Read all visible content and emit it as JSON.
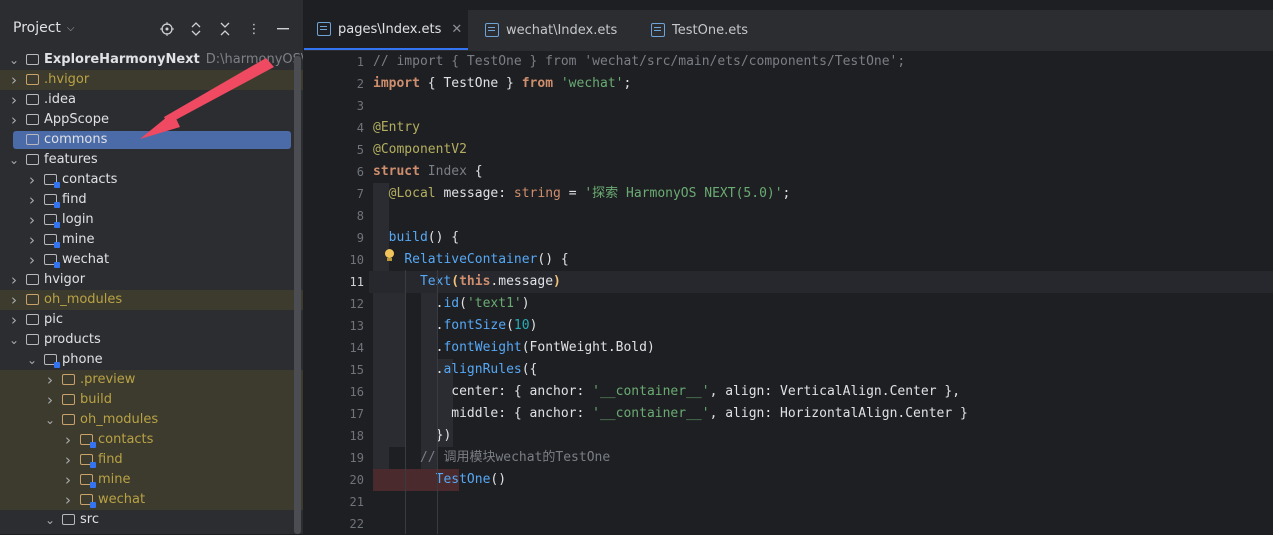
{
  "project_panel": {
    "title": "Project",
    "actions": [
      "locate-icon",
      "expand-collapse-icon",
      "collapse-all-icon",
      "more-icon",
      "hide-icon"
    ]
  },
  "tree": [
    {
      "label": "ExploreHarmonyNext",
      "path": "D:\\harmonyOS\\public\\",
      "indent": 0,
      "expanded": true,
      "bold": true,
      "style": "normal"
    },
    {
      "label": ".hvigor",
      "indent": 0,
      "expanded": false,
      "style": "excluded"
    },
    {
      "label": ".idea",
      "indent": 0,
      "expanded": false,
      "style": "normal"
    },
    {
      "label": "AppScope",
      "indent": 0,
      "expanded": false,
      "style": "normal"
    },
    {
      "label": "commons",
      "indent": 0,
      "expanded": null,
      "style": "selected"
    },
    {
      "label": "features",
      "indent": 0,
      "expanded": true,
      "style": "normal"
    },
    {
      "label": "contacts",
      "indent": 1,
      "expanded": false,
      "style": "normal",
      "module": true
    },
    {
      "label": "find",
      "indent": 1,
      "expanded": false,
      "style": "normal",
      "module": true
    },
    {
      "label": "login",
      "indent": 1,
      "expanded": false,
      "style": "normal",
      "module": true
    },
    {
      "label": "mine",
      "indent": 1,
      "expanded": false,
      "style": "normal",
      "module": true
    },
    {
      "label": "wechat",
      "indent": 1,
      "expanded": false,
      "style": "normal",
      "module": true
    },
    {
      "label": "hvigor",
      "indent": 0,
      "expanded": false,
      "style": "normal"
    },
    {
      "label": "oh_modules",
      "indent": 0,
      "expanded": false,
      "style": "excluded"
    },
    {
      "label": "pic",
      "indent": 0,
      "expanded": false,
      "style": "normal"
    },
    {
      "label": "products",
      "indent": 0,
      "expanded": true,
      "style": "normal"
    },
    {
      "label": "phone",
      "indent": 1,
      "expanded": true,
      "style": "normal",
      "module": true
    },
    {
      "label": ".preview",
      "indent": 2,
      "expanded": false,
      "style": "excluded"
    },
    {
      "label": "build",
      "indent": 2,
      "expanded": false,
      "style": "excluded"
    },
    {
      "label": "oh_modules",
      "indent": 2,
      "expanded": true,
      "style": "excluded"
    },
    {
      "label": "contacts",
      "indent": 3,
      "expanded": false,
      "style": "excluded",
      "module": true
    },
    {
      "label": "find",
      "indent": 3,
      "expanded": false,
      "style": "excluded",
      "module": true
    },
    {
      "label": "mine",
      "indent": 3,
      "expanded": false,
      "style": "excluded",
      "module": true
    },
    {
      "label": "wechat",
      "indent": 3,
      "expanded": false,
      "style": "excluded",
      "module": true
    },
    {
      "label": "src",
      "indent": 2,
      "expanded": true,
      "style": "normal"
    }
  ],
  "tabs": [
    {
      "label": "pages\\Index.ets",
      "active": true,
      "closable": true
    },
    {
      "label": "wechat\\Index.ets",
      "active": false,
      "closable": false
    },
    {
      "label": "TestOne.ets",
      "active": false,
      "closable": false
    }
  ],
  "current_line": 11,
  "code_lines": [
    [
      [
        "cm",
        "// import { TestOne } from 'wechat/src/main/ets/components/TestOne';"
      ]
    ],
    [
      [
        "kw",
        "import"
      ],
      [
        "pl",
        " { TestOne } "
      ],
      [
        "kw",
        "from"
      ],
      [
        "pl",
        " "
      ],
      [
        "str",
        "'wechat'"
      ],
      [
        "pl",
        ";"
      ]
    ],
    [],
    [
      [
        "dec",
        "@Entry"
      ]
    ],
    [
      [
        "dec",
        "@ComponentV2"
      ]
    ],
    [
      [
        "kw",
        "struct"
      ],
      [
        "pl",
        " "
      ],
      [
        "cm",
        "Index"
      ],
      [
        "pl",
        " {"
      ]
    ],
    [
      [
        "pl",
        "  "
      ],
      [
        "dec",
        "@Local"
      ],
      [
        "pl",
        " message: "
      ],
      [
        "ty",
        "string"
      ],
      [
        "pl",
        " = "
      ],
      [
        "str",
        "'探索 HarmonyOS NEXT(5.0)'"
      ],
      [
        "pl",
        ";"
      ]
    ],
    [],
    [
      [
        "pl",
        "  "
      ],
      [
        "fn",
        "build"
      ],
      [
        "pl",
        "() {"
      ]
    ],
    [
      [
        "pl",
        "    "
      ],
      [
        "fn",
        "RelativeContainer"
      ],
      [
        "pl",
        "() {"
      ]
    ],
    [
      [
        "pl",
        "      "
      ],
      [
        "fn",
        "Text"
      ],
      [
        "kw2",
        "("
      ],
      [
        "kw",
        "this"
      ],
      [
        "pl",
        ".message"
      ],
      [
        "kw2",
        ")"
      ]
    ],
    [
      [
        "pl",
        "        ."
      ],
      [
        "fn",
        "id"
      ],
      [
        "pl",
        "("
      ],
      [
        "str",
        "'text1'"
      ],
      [
        "pl",
        ")"
      ]
    ],
    [
      [
        "pl",
        "        ."
      ],
      [
        "fn",
        "fontSize"
      ],
      [
        "pl",
        "("
      ],
      [
        "num",
        "10"
      ],
      [
        "pl",
        ")"
      ]
    ],
    [
      [
        "pl",
        "        ."
      ],
      [
        "fn",
        "fontWeight"
      ],
      [
        "pl",
        "(FontWeight.Bold)"
      ]
    ],
    [
      [
        "pl",
        "        ."
      ],
      [
        "fn",
        "alignRules"
      ],
      [
        "pl",
        "({"
      ]
    ],
    [
      [
        "pl",
        "          center: { anchor: "
      ],
      [
        "str",
        "'__container__'"
      ],
      [
        "pl",
        ", align: VerticalAlign.Center },"
      ]
    ],
    [
      [
        "pl",
        "          middle: { anchor: "
      ],
      [
        "str",
        "'__container__'"
      ],
      [
        "pl",
        ", align: HorizontalAlign.Center }"
      ]
    ],
    [
      [
        "pl",
        "        })"
      ]
    ],
    [
      [
        "pl",
        "      "
      ],
      [
        "cm",
        "// 调用模块wechat的TestOne"
      ]
    ],
    [
      [
        "pl",
        "        "
      ],
      [
        "fn",
        "TestOne"
      ],
      [
        "pl",
        "()"
      ]
    ],
    [],
    []
  ]
}
